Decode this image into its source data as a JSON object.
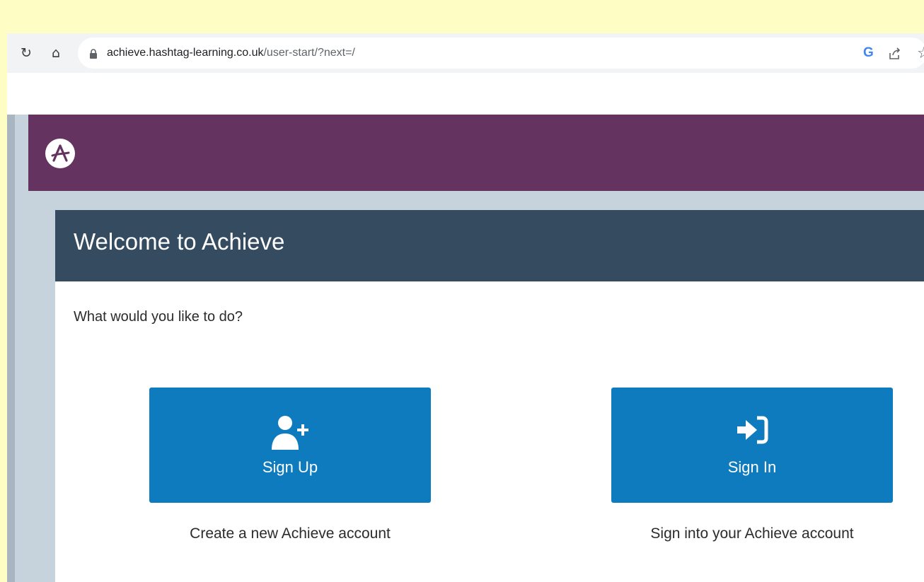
{
  "browser": {
    "url_domain": "achieve.hashtag-learning.co.uk",
    "url_path": "/user-start/?next=/",
    "reload_icon": "reload-icon",
    "home_icon": "home-icon",
    "lock_icon": "lock-icon",
    "google_icon": "G",
    "share_icon": "share-icon",
    "bookmark_icon": "star-icon"
  },
  "app": {
    "logo_icon": "achieve-logo",
    "brand_color": "#643360",
    "header_color": "#354b60",
    "button_color": "#0f7bbf"
  },
  "card": {
    "title": "Welcome to Achieve",
    "prompt": "What would you like to do?",
    "actions": [
      {
        "label": "Sign Up",
        "description": "Create a new Achieve account",
        "icon": "user-plus-icon"
      },
      {
        "label": "Sign In",
        "description": "Sign into your Achieve account",
        "icon": "sign-in-icon"
      }
    ]
  }
}
